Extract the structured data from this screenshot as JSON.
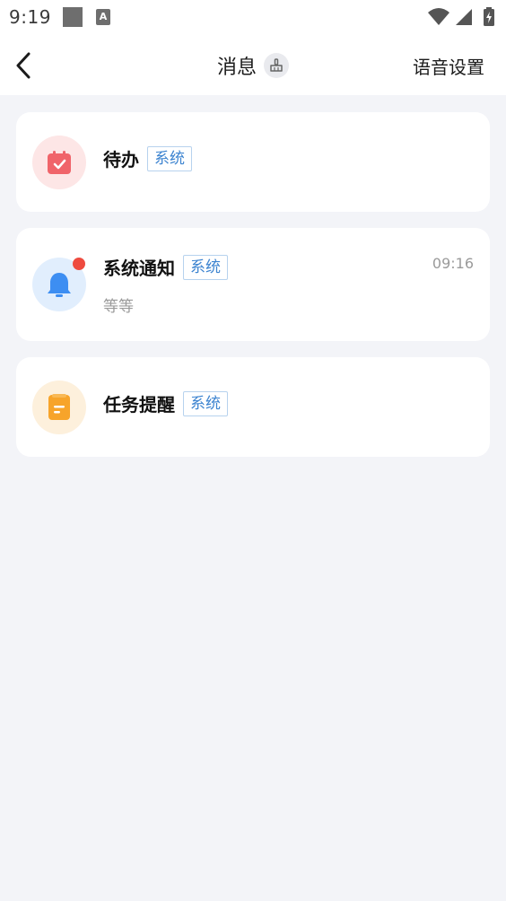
{
  "status_bar": {
    "time": "9:19",
    "notification_icon_letter": "A",
    "icons": [
      "wifi-icon",
      "cellular-signal-icon",
      "battery-charging-icon"
    ]
  },
  "header": {
    "title": "消息",
    "clear_icon": "broom-icon",
    "right_action": "语音设置",
    "back_icon": "chevron-left-icon"
  },
  "messages": [
    {
      "title": "待办",
      "tag": "系统",
      "icon": "todo-calendar-check-icon",
      "icon_bg": "#fde6e6",
      "icon_color": "#f0646a",
      "time": "",
      "preview": "",
      "unread": false
    },
    {
      "title": "系统通知",
      "tag": "系统",
      "icon": "bell-icon",
      "icon_bg": "#e1eefd",
      "icon_color": "#3d8ef2",
      "time": "09:16",
      "preview": "等等",
      "unread": true
    },
    {
      "title": "任务提醒",
      "tag": "系统",
      "icon": "task-note-icon",
      "icon_bg": "#fdf0dc",
      "icon_color": "#f7a42a",
      "time": "",
      "preview": "",
      "unread": false
    }
  ],
  "colors": {
    "page_background": "#f3f4f8",
    "card_background": "#ffffff",
    "tag_text": "#3d84d0",
    "tag_border": "#b7d2ee",
    "unread_dot": "#ee4b3f"
  }
}
